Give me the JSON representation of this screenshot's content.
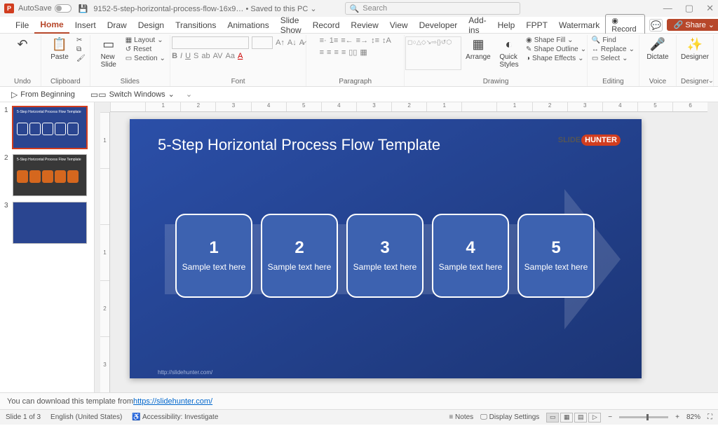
{
  "titlebar": {
    "autosave_label": "AutoSave",
    "filename": "9152-5-step-horizontal-process-flow-16x9… • Saved to this PC ⌄",
    "search_placeholder": "Search"
  },
  "tabs": [
    "File",
    "Home",
    "Insert",
    "Draw",
    "Design",
    "Transitions",
    "Animations",
    "Slide Show",
    "Record",
    "Review",
    "View",
    "Developer",
    "Add-ins",
    "Help",
    "FPPT",
    "Watermark"
  ],
  "active_tab": "Home",
  "topright": {
    "record": "Record",
    "share": "Share"
  },
  "ribbon": {
    "undo": "Undo",
    "paste": "Paste",
    "clipboard": "Clipboard",
    "newslide": "New\nSlide",
    "slides": "Slides",
    "layout": "Layout",
    "reset": "Reset",
    "section": "Section",
    "font": "Font",
    "paragraph": "Paragraph",
    "arrange": "Arrange",
    "quick": "Quick\nStyles",
    "drawing": "Drawing",
    "shapefill": "Shape Fill",
    "shapeoutline": "Shape Outline",
    "shapeeffects": "Shape Effects",
    "find": "Find",
    "replace": "Replace",
    "select": "Select",
    "editing": "Editing",
    "dictate": "Dictate",
    "voice": "Voice",
    "designer": "Designer",
    "designer_grp": "Designer"
  },
  "qat": {
    "from_beginning": "From Beginning",
    "switch_windows": "Switch Windows"
  },
  "thumbs": [
    "1",
    "2",
    "3"
  ],
  "slide": {
    "title": "5-Step Horizontal Process Flow Template",
    "logo1": "SLIDE",
    "logo2": "HUNTER",
    "steps": [
      {
        "num": "1",
        "txt": "Sample text here"
      },
      {
        "num": "2",
        "txt": "Sample text here"
      },
      {
        "num": "3",
        "txt": "Sample text here"
      },
      {
        "num": "4",
        "txt": "Sample text here"
      },
      {
        "num": "5",
        "txt": "Sample text here"
      }
    ],
    "footer": "http://slidehunter.com/"
  },
  "notes": {
    "prefix": "You can download this template from ",
    "link": "https://slidehunter.com/"
  },
  "status": {
    "slide": "Slide 1 of 3",
    "lang": "English (United States)",
    "access": "Accessibility: Investigate",
    "notes": "Notes",
    "display": "Display Settings",
    "zoom": "82%"
  },
  "ruler_h": [
    "",
    "1",
    "2",
    "3",
    "4",
    "5",
    "4",
    "3",
    "2",
    "1",
    "",
    "1",
    "2",
    "3",
    "4",
    "5",
    "6"
  ],
  "ruler_v": [
    "1",
    "",
    "1",
    "2",
    "3"
  ]
}
